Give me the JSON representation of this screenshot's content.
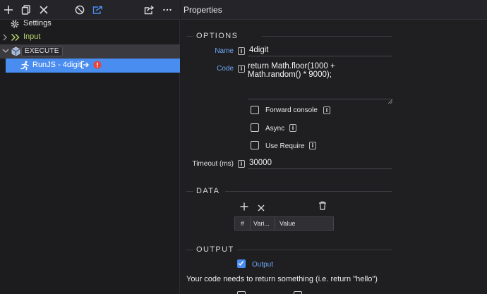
{
  "toolbar": {
    "icons": [
      "plus-icon",
      "copy-icon",
      "close-icon",
      "disable-icon",
      "export-icon",
      "share-icon",
      "more-icon"
    ]
  },
  "tree": {
    "settings_label": "Settings",
    "input_label": "Input",
    "execute_label": "EXECUTE",
    "runjs_label": "RunJS - 4digit"
  },
  "properties": {
    "title": "Properties",
    "options": {
      "section_title": "OPTIONS",
      "name_label": "Name",
      "name_value": "4digit",
      "code_label": "Code",
      "code_value": "return Math.floor(1000 +\nMath.random() * 9000);",
      "forward_console_label": "Forward console",
      "forward_console_checked": false,
      "async_label": "Async",
      "async_checked": false,
      "use_require_label": "Use Require",
      "use_require_checked": false,
      "timeout_label": "Timeout (ms)",
      "timeout_value": "30000"
    },
    "data": {
      "section_title": "DATA",
      "columns": [
        "#",
        "Vari...",
        "Value"
      ]
    },
    "output": {
      "section_title": "OUTPUT",
      "output_label": "Output",
      "output_checked": true,
      "hint": "Your code needs to return something (i.e. return \"hello\")"
    }
  },
  "colors": {
    "accent": "#4a8df0",
    "label_blue": "#6fa8f5",
    "input_green": "#b7d36b",
    "error_red": "#e5453b"
  }
}
